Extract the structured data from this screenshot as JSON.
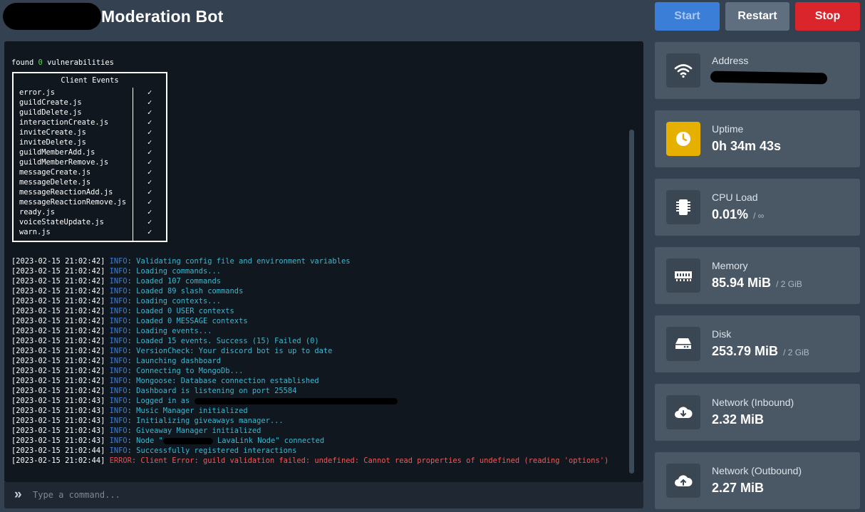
{
  "header": {
    "title": "Moderation Bot",
    "buttons": {
      "start": "Start",
      "restart": "Restart",
      "stop": "Stop"
    }
  },
  "console": {
    "found_prefix": "found ",
    "found_count": "0",
    "found_suffix": " vulnerabilities",
    "events_table": {
      "title": "Client Events",
      "check_mark": "✓",
      "rows": [
        "error.js",
        "guildCreate.js",
        "guildDelete.js",
        "interactionCreate.js",
        "inviteCreate.js",
        "inviteDelete.js",
        "guildMemberAdd.js",
        "guildMemberRemove.js",
        "messageCreate.js",
        "messageDelete.js",
        "messageReactionAdd.js",
        "messageReactionRemove.js",
        "ready.js",
        "voiceStateUpdate.js",
        "warn.js"
      ]
    },
    "logs": [
      {
        "ts": "[2023-02-15 21:02:42]",
        "level": "INFO",
        "msg": ": Validating config file and environment variables"
      },
      {
        "ts": "[2023-02-15 21:02:42]",
        "level": "INFO",
        "msg": ": Loading commands..."
      },
      {
        "ts": "[2023-02-15 21:02:42]",
        "level": "INFO",
        "msg": ": Loaded 107 commands"
      },
      {
        "ts": "[2023-02-15 21:02:42]",
        "level": "INFO",
        "msg": ": Loaded 89 slash commands"
      },
      {
        "ts": "[2023-02-15 21:02:42]",
        "level": "INFO",
        "msg": ": Loading contexts..."
      },
      {
        "ts": "[2023-02-15 21:02:42]",
        "level": "INFO",
        "msg": ": Loaded 0 USER contexts"
      },
      {
        "ts": "[2023-02-15 21:02:42]",
        "level": "INFO",
        "msg": ": Loaded 0 MESSAGE contexts"
      },
      {
        "ts": "[2023-02-15 21:02:42]",
        "level": "INFO",
        "msg": ": Loading events..."
      },
      {
        "ts": "[2023-02-15 21:02:42]",
        "level": "INFO",
        "msg": ": Loaded 15 events. Success (15) Failed (0)"
      },
      {
        "ts": "[2023-02-15 21:02:42]",
        "level": "INFO",
        "msg": ": VersionCheck: Your discord bot is up to date"
      },
      {
        "ts": "[2023-02-15 21:02:42]",
        "level": "INFO",
        "msg": ": Launching dashboard"
      },
      {
        "ts": "[2023-02-15 21:02:42]",
        "level": "INFO",
        "msg": ": Connecting to MongoDb..."
      },
      {
        "ts": "[2023-02-15 21:02:42]",
        "level": "INFO",
        "msg": ": Mongoose: Database connection established"
      },
      {
        "ts": "[2023-02-15 21:02:42]",
        "level": "INFO",
        "msg": ": Dashboard is listening on port 25584"
      },
      {
        "ts": "[2023-02-15 21:02:43]",
        "level": "INFO",
        "msg": ": Logged in as ",
        "redact": "logged-in"
      },
      {
        "ts": "[2023-02-15 21:02:43]",
        "level": "INFO",
        "msg": ": Music Manager initialized"
      },
      {
        "ts": "[2023-02-15 21:02:43]",
        "level": "INFO",
        "msg": ": Initializing giveaways manager..."
      },
      {
        "ts": "[2023-02-15 21:02:43]",
        "level": "INFO",
        "msg": ": Giveaway Manager initialized"
      },
      {
        "ts": "[2023-02-15 21:02:43]",
        "level": "INFO",
        "msg": ": Node \"",
        "redact": "node",
        "msg2": " LavaLink Node\" connected"
      },
      {
        "ts": "[2023-02-15 21:02:44]",
        "level": "INFO",
        "msg": ": Successfully registered interactions"
      },
      {
        "ts": "[2023-02-15 21:02:44]",
        "level": "ERROR",
        "msg": ": Client Error: guild validation failed: undefined: Cannot read properties of undefined (reading 'options')"
      }
    ],
    "input_placeholder": "Type a command..."
  },
  "stats": {
    "address": {
      "label": "Address",
      "icon": "wifi-icon"
    },
    "uptime": {
      "label": "Uptime",
      "value": "0h 34m 43s",
      "icon": "clock-icon"
    },
    "cpu": {
      "label": "CPU Load",
      "value": "0.01%",
      "limit": "/ ∞",
      "icon": "cpu-chip-icon"
    },
    "memory": {
      "label": "Memory",
      "value": "85.94 MiB",
      "limit": "/ 2 GiB",
      "icon": "memory-icon"
    },
    "disk": {
      "label": "Disk",
      "value": "253.79 MiB",
      "limit": "/ 2 GiB",
      "icon": "hard-drive-icon"
    },
    "net_in": {
      "label": "Network (Inbound)",
      "value": "2.32 MiB",
      "icon": "cloud-download-icon"
    },
    "net_out": {
      "label": "Network (Outbound)",
      "value": "2.27 MiB",
      "icon": "cloud-upload-icon"
    }
  },
  "colors": {
    "background": "#334150",
    "console_bg": "#10171e",
    "card_bg": "#4a5866",
    "start_button": "#3b7ed8",
    "restart_button": "#5f6f80",
    "stop_button": "#d9252b",
    "info": "#3a7fd8",
    "log_text": "#3fb6cf",
    "error": "#ee4848",
    "uptime_icon_bg": "#e6b000"
  }
}
